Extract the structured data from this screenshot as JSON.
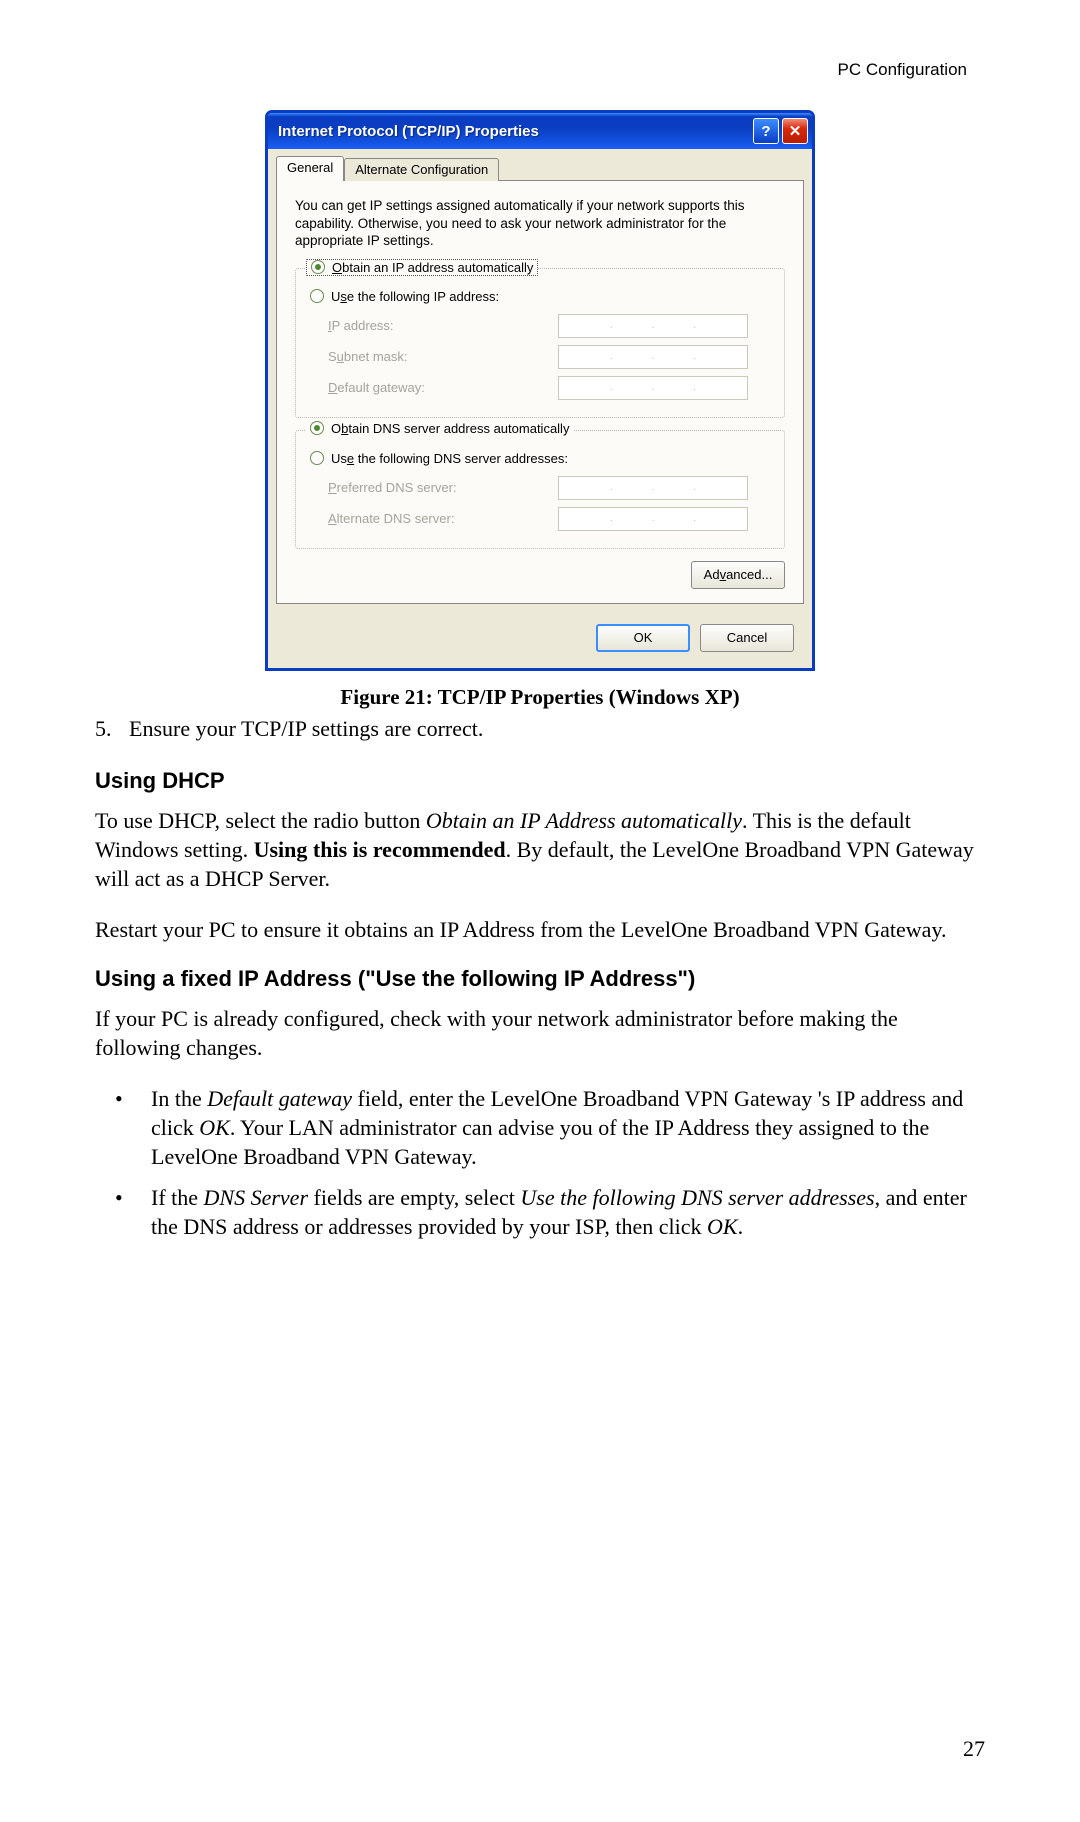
{
  "header": {
    "right": "PC Configuration"
  },
  "dialog": {
    "title": "Internet Protocol (TCP/IP) Properties",
    "help_icon": "?",
    "close_icon": "✕",
    "tabs": {
      "general": "General",
      "alternate": "Alternate Configuration"
    },
    "description": "You can get IP settings assigned automatically if your network supports this capability. Otherwise, you need to ask your network administrator for the appropriate IP settings.",
    "ip_group": {
      "auto": {
        "pre": "",
        "u": "O",
        "post": "btain an IP address automatically"
      },
      "manual": {
        "pre": "U",
        "u": "s",
        "post": "e the following IP address:"
      },
      "fields": {
        "ip": {
          "pre": "",
          "u": "I",
          "post": "P address:"
        },
        "subnet": {
          "pre": "S",
          "u": "u",
          "post": "bnet mask:"
        },
        "gateway": {
          "pre": "",
          "u": "D",
          "post": "efault gateway:"
        }
      }
    },
    "dns_group": {
      "auto": {
        "pre": "O",
        "u": "b",
        "post": "tain DNS server address automatically"
      },
      "manual": {
        "pre": "Us",
        "u": "e",
        "post": " the following DNS server addresses:"
      },
      "fields": {
        "preferred": {
          "pre": "",
          "u": "P",
          "post": "referred DNS server:"
        },
        "alternate": {
          "pre": "",
          "u": "A",
          "post": "lternate DNS server:"
        }
      }
    },
    "advanced": {
      "pre": "Ad",
      "u": "v",
      "post": "anced..."
    },
    "ok": "OK",
    "cancel": "Cancel"
  },
  "caption": "Figure 21: TCP/IP Properties (Windows XP)",
  "step5": {
    "num": "5.",
    "text": "Ensure your TCP/IP settings are correct."
  },
  "dhcp": {
    "heading": "Using DHCP",
    "p1": {
      "a": "To use DHCP, select the radio button ",
      "b": "Obtain an IP Address automatically",
      "c": ". This is the default Windows setting. ",
      "d": "Using this is recommended",
      "e": ". By default, the LevelOne Broadband VPN Gateway will act as a DHCP Server."
    },
    "p2": "Restart your PC to ensure it obtains an IP Address from the LevelOne Broadband VPN Gateway."
  },
  "fixed": {
    "heading": "Using a fixed IP Address (\"Use the following IP Address\")",
    "p1": "If your PC is already configured, check with your network administrator before making the following changes.",
    "b1": {
      "a": "In the ",
      "b": "Default gateway",
      "c": " field, enter the LevelOne Broadband VPN Gateway 's IP address and click ",
      "d": "OK",
      "e": ". Your LAN administrator can advise you of the IP Address they assigned to the LevelOne Broadband VPN Gateway."
    },
    "b2": {
      "a": "If the ",
      "b": "DNS Server",
      "c": " fields are empty, select ",
      "d": "Use the following DNS server addresses",
      "e": ", and enter the DNS address or addresses provided by your ISP, then click ",
      "f": "OK",
      "g": "."
    }
  },
  "page_num": "27"
}
